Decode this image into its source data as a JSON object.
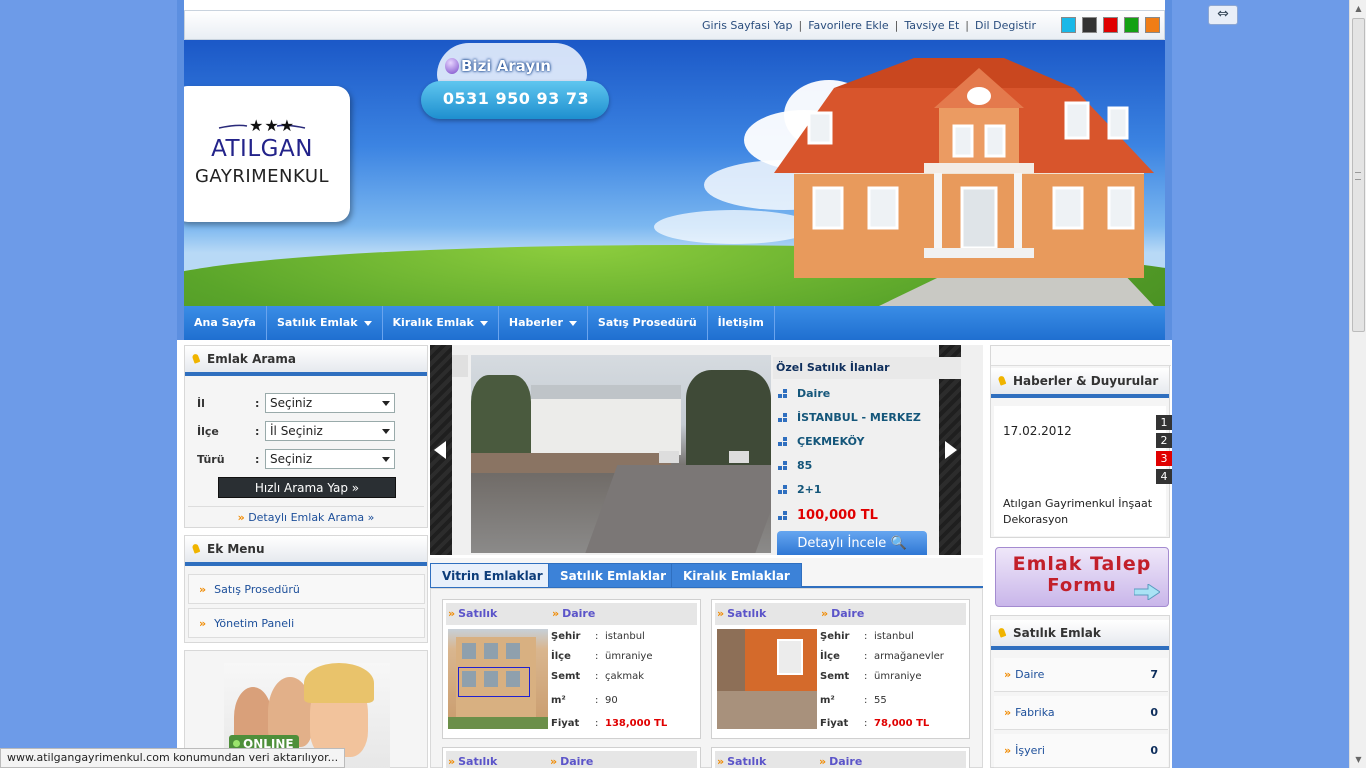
{
  "topbar": {
    "links": [
      "Giris Sayfasi Yap",
      "Favorilere Ekle",
      "Tavsiye Et",
      "Dil Degistir"
    ],
    "swatches": [
      "#19b8e8",
      "#333333",
      "#e00000",
      "#13a113",
      "#f07d16"
    ]
  },
  "logo": {
    "name": "ATILGAN",
    "sub": "GAYRIMENKUL"
  },
  "call": {
    "title": "Bizi Arayın",
    "phone": "0531 950 93 73"
  },
  "nav": [
    {
      "label": "Ana Sayfa",
      "dropdown": false
    },
    {
      "label": "Satılık Emlak",
      "dropdown": true
    },
    {
      "label": "Kiralık Emlak",
      "dropdown": true
    },
    {
      "label": "Haberler",
      "dropdown": true
    },
    {
      "label": "Satış Prosedürü",
      "dropdown": false
    },
    {
      "label": "İletişim",
      "dropdown": false
    }
  ],
  "search": {
    "title": "Emlak Arama",
    "fields": [
      {
        "label": "İl",
        "colon": ":",
        "value": "Seçiniz"
      },
      {
        "label": "İlçe",
        "colon": ":",
        "value": "İl Seçiniz"
      },
      {
        "label": "Türü",
        "colon": ":",
        "value": "Seçiniz"
      }
    ],
    "button": "Hızlı Arama Yap »",
    "detail_link": "Detaylı Emlak Arama »"
  },
  "ekmenu": {
    "title": "Ek Menu",
    "items": [
      "Satış Prosedürü",
      "Yönetim Paneli"
    ]
  },
  "online_badge": "ONLINE",
  "featured": {
    "heading": "Özel Satılık İlanlar",
    "lines": [
      "Daire",
      "İSTANBUL - MERKEZ",
      "ÇEKMEKÖY",
      "85",
      "2+1"
    ],
    "price": "100,000 TL",
    "button": "Detaylı İncele"
  },
  "tabs": [
    "Vitrin Emlaklar",
    "Satılık Emlaklar",
    "Kiralık Emlaklar"
  ],
  "listings": [
    {
      "status": "Satılık",
      "type": "Daire",
      "labels": [
        "Şehir",
        "İlçe",
        "Semt",
        "m²",
        "Fiyat"
      ],
      "values": [
        "istanbul",
        "ümraniye",
        "çakmak",
        "90",
        "138,000 TL"
      ]
    },
    {
      "status": "Satılık",
      "type": "Daire",
      "labels": [
        "Şehir",
        "İlçe",
        "Semt",
        "m²",
        "Fiyat"
      ],
      "values": [
        "istanbul",
        "armağanevler",
        "ümraniye",
        "55",
        "78,000 TL"
      ]
    }
  ],
  "listings_row2": [
    {
      "status": "Satılık",
      "type": "Daire"
    },
    {
      "status": "Satılık",
      "type": "Daire"
    }
  ],
  "news": {
    "title": "Haberler & Duyurular",
    "date": "17.02.2012",
    "text": "Atılgan Gayrimenkul İnşaat Dekorasyon",
    "pages": [
      "1",
      "2",
      "3",
      "4"
    ],
    "active_page": "3"
  },
  "talep": {
    "line1": "Emlak Talep",
    "line2": "Formu"
  },
  "satilik": {
    "title": "Satılık Emlak",
    "items": [
      {
        "label": "Daire",
        "count": "7"
      },
      {
        "label": "Fabrika",
        "count": "0"
      },
      {
        "label": "İşyeri",
        "count": "0"
      }
    ]
  },
  "status_text": "www.atilgangayrimenkul.com konumundan veri aktarılıyor..."
}
